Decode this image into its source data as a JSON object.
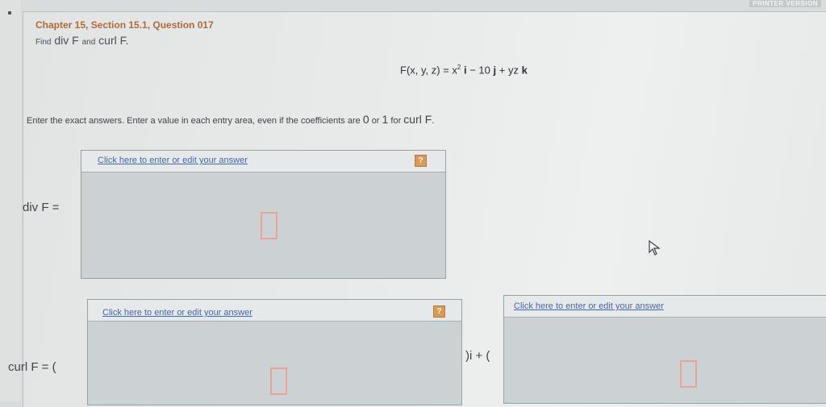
{
  "header": {
    "chapter_title": "Chapter 15, Section 15.1, Question 017",
    "corner_tag": "PRINTER VERSION"
  },
  "question": {
    "find_word": "Find",
    "div_f": "div F",
    "and_word": "and",
    "curl_f": "curl F",
    "period": ".",
    "vector_field": {
      "lhs": "F(x, y, z) = x",
      "exponent": "2",
      "i_unit": "i",
      "middle": " − 10 ",
      "j_unit": "j",
      "plus_yz": " + yz ",
      "k_unit": "k"
    },
    "instructions": {
      "text": "Enter the exact answers. Enter a value in each entry area, even if the coefficients are",
      "zero": "0",
      "or_word": "or",
      "one": "1",
      "for_word": "for",
      "curl_f": "curl F",
      "period": "."
    }
  },
  "answers": {
    "div": {
      "label": "div F =",
      "link_text": "Click here to enter or edit your answer",
      "help": "?"
    },
    "curl_i": {
      "label": "curl F = (",
      "link_text": "Click here to enter or edit your answer",
      "help": "?"
    },
    "between_label": ")i + (",
    "curl_j": {
      "link_text": "Click here to enter or edit your answer"
    }
  }
}
